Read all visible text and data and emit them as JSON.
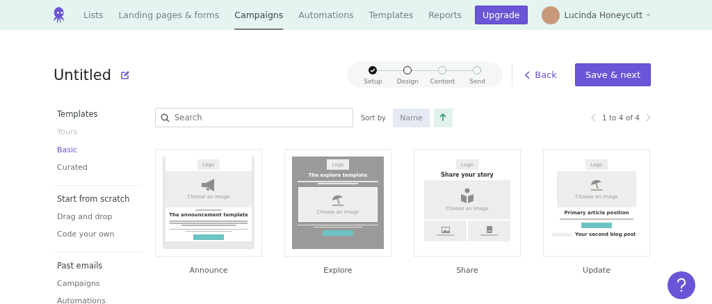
{
  "nav": {
    "links": [
      {
        "label": "Lists",
        "selected": false
      },
      {
        "label": "Landing pages & forms",
        "selected": false
      },
      {
        "label": "Campaigns",
        "selected": true
      },
      {
        "label": "Automations",
        "selected": false
      },
      {
        "label": "Templates",
        "selected": false
      },
      {
        "label": "Reports",
        "selected": false
      }
    ],
    "upgrade": "Upgrade",
    "user": "Lucinda Honeycutt"
  },
  "title": "Untitled",
  "steps": [
    {
      "label": "Setup",
      "completed": true,
      "selected": false
    },
    {
      "label": "Design",
      "completed": false,
      "selected": true
    },
    {
      "label": "Content",
      "completed": false,
      "selected": false
    },
    {
      "label": "Send",
      "completed": false,
      "selected": false
    }
  ],
  "back": "Back",
  "save": "Save & next",
  "sidebar": [
    {
      "heading": "Templates",
      "items": [
        {
          "label": "Yours",
          "selected": false,
          "disabled": true
        },
        {
          "label": "Basic",
          "selected": true,
          "disabled": false
        },
        {
          "label": "Curated",
          "selected": false,
          "disabled": false
        }
      ]
    },
    {
      "heading": "Start from scratch",
      "items": [
        {
          "label": "Drag and drop",
          "selected": false,
          "disabled": false
        },
        {
          "label": "Code your own",
          "selected": false,
          "disabled": false
        }
      ]
    },
    {
      "heading": "Past emails",
      "items": [
        {
          "label": "Campaigns",
          "selected": false,
          "disabled": false
        },
        {
          "label": "Automations",
          "selected": false,
          "disabled": false
        }
      ]
    }
  ],
  "search": {
    "placeholder": "Search"
  },
  "sort": {
    "label": "Sort by",
    "field": "Name"
  },
  "pagination": "1 to 4 of 4",
  "templates": [
    {
      "name": "Announce",
      "kind": "announce",
      "logo": "Logo",
      "image_label": "Choose an image",
      "heading": "The announcement template"
    },
    {
      "name": "Explore",
      "kind": "explore",
      "logo": "Logo",
      "heading": "The explore template",
      "image_label": "Choose an image"
    },
    {
      "name": "Share",
      "kind": "share",
      "logo": "Logo",
      "heading": "Share your story",
      "image_label": "Choose an image"
    },
    {
      "name": "Update",
      "kind": "update",
      "logo": "Logo",
      "image_label": "Choose an image",
      "heading": "Primary article position",
      "second_heading": "Your second blog post"
    }
  ]
}
